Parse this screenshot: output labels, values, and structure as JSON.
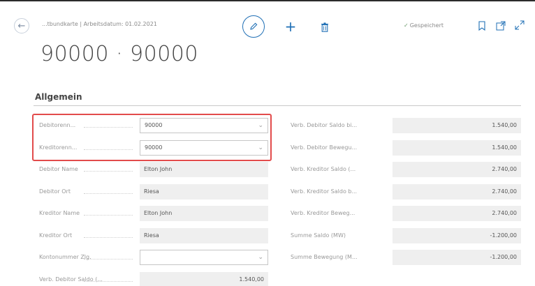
{
  "header": {
    "breadcrumb": "...tbundkarte | Arbeitsdatum: 01.02.2021",
    "title": "90000 · 90000",
    "saved_label": "Gespeichert"
  },
  "icons": {
    "back": "back-arrow-icon",
    "edit": "pencil-icon",
    "new": "plus-icon",
    "delete": "trash-icon",
    "saved": "check-icon",
    "bookmark": "bookmark-icon",
    "open_new": "open-in-new-window-icon",
    "expand": "expand-icon"
  },
  "colors": {
    "accent": "#1f6fb5",
    "highlight": "#e24b4b"
  },
  "section": {
    "title": "Allgemein"
  },
  "left_fields": [
    {
      "label": "Debitorenn...",
      "value": "90000",
      "type": "select"
    },
    {
      "label": "Kreditorenn...",
      "value": "90000",
      "type": "select"
    },
    {
      "label": "Debitor Name",
      "value": "Elton John",
      "type": "readonly"
    },
    {
      "label": "Debitor Ort",
      "value": "Riesa",
      "type": "readonly"
    },
    {
      "label": "Kreditor Name",
      "value": "Elton John",
      "type": "readonly"
    },
    {
      "label": "Kreditor Ort",
      "value": "Riesa",
      "type": "readonly"
    },
    {
      "label": "Kontonummer Zlg.",
      "value": "",
      "type": "select"
    },
    {
      "label": "Verb. Debitor Saldo (...",
      "value": "1.540,00",
      "type": "readonly-right"
    }
  ],
  "right_fields": [
    {
      "label": "Verb. Debitor Saldo bi...",
      "value": "1.540,00"
    },
    {
      "label": "Verb. Debitor Bewegu...",
      "value": "1.540,00"
    },
    {
      "label": "Verb. Kreditor Saldo (...",
      "value": "2.740,00"
    },
    {
      "label": "Verb. Kreditor Saldo b...",
      "value": "2.740,00"
    },
    {
      "label": "Verb. Kreditor Beweg...",
      "value": "2.740,00"
    },
    {
      "label": "Summe Saldo (MW)",
      "value": "-1.200,00"
    },
    {
      "label": "Summe Bewegung (M...",
      "value": "-1.200,00"
    }
  ]
}
